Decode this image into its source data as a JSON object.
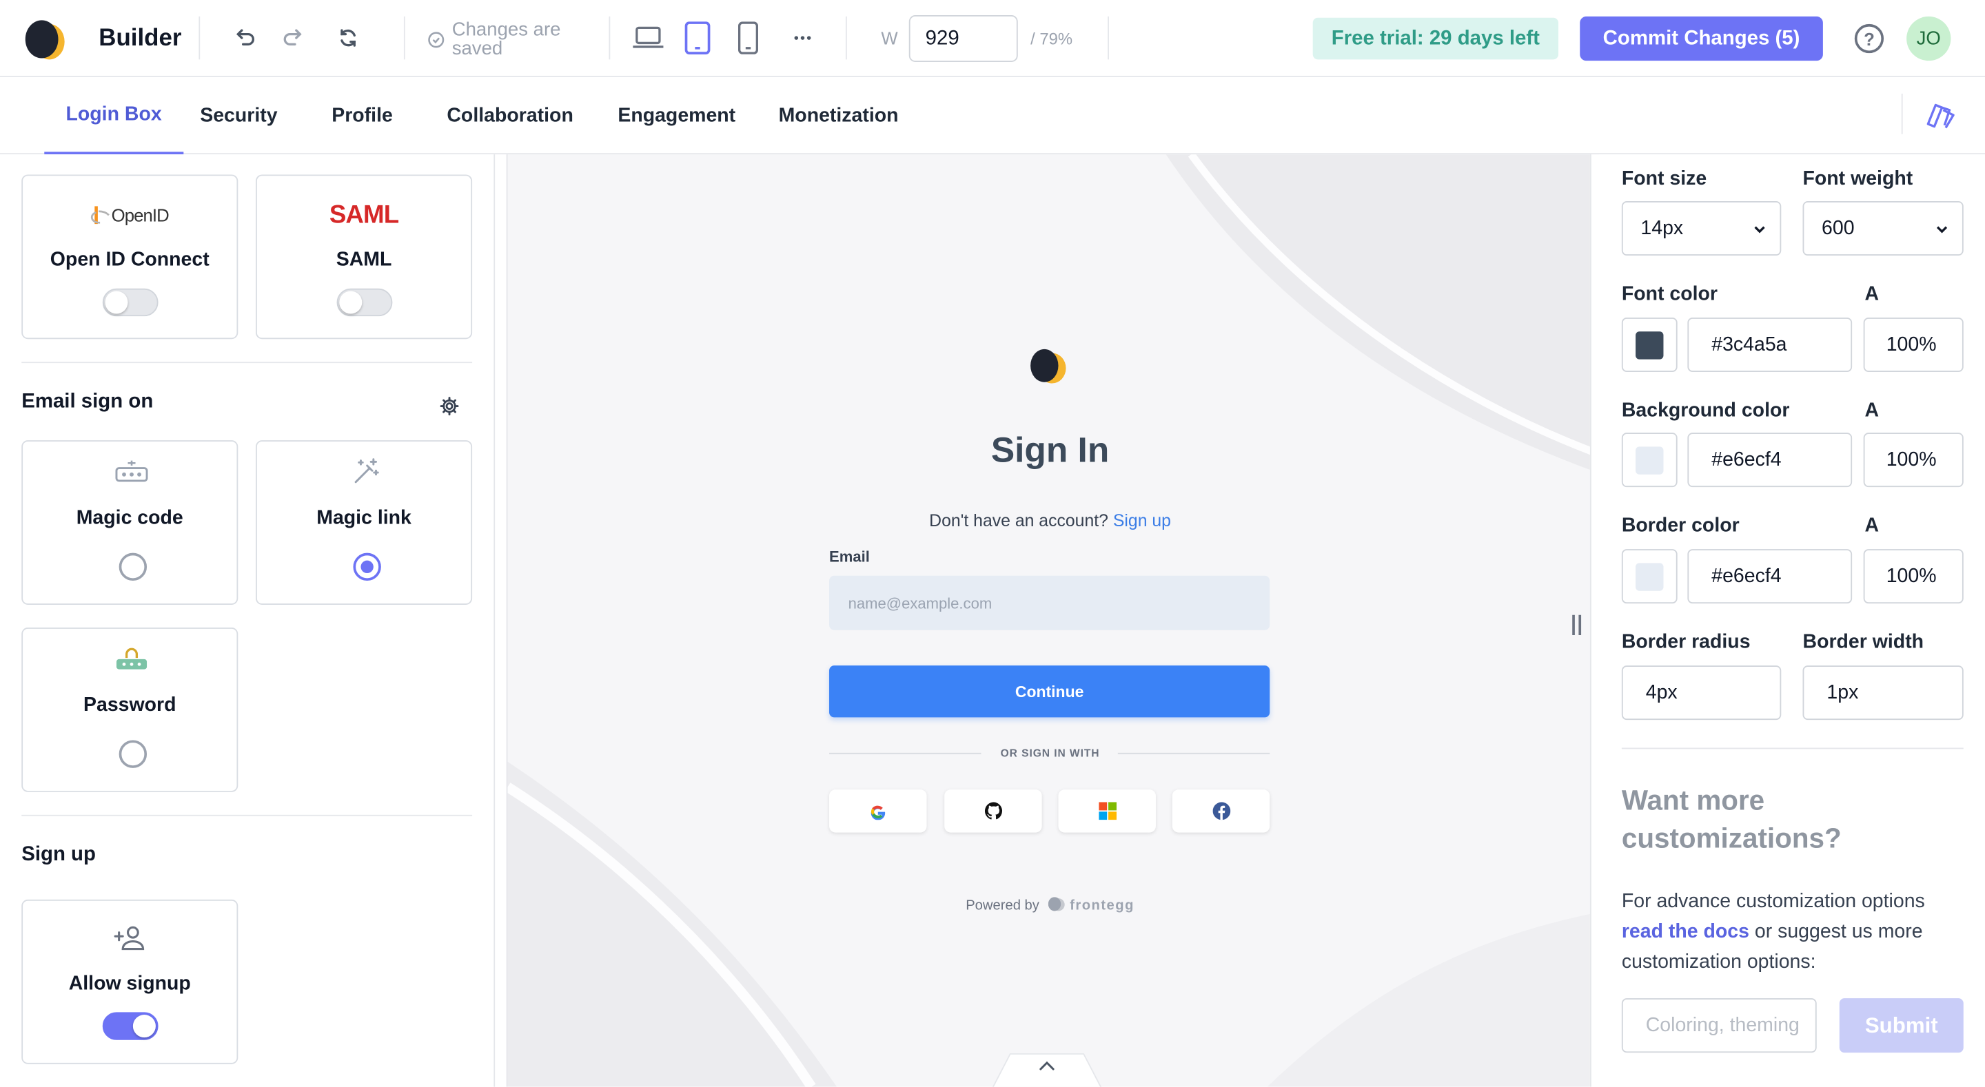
{
  "header": {
    "brand": "Builder",
    "saved_status": "Changes are saved",
    "width_label": "W",
    "width_value": "929",
    "zoom": "/ 79%",
    "trial_badge": "Free trial: 29 days left",
    "commit_button": "Commit Changes (5)",
    "help": "?",
    "avatar_initials": "JO"
  },
  "tabs": [
    {
      "label": "Login Box",
      "active": true
    },
    {
      "label": "Security"
    },
    {
      "label": "Profile"
    },
    {
      "label": "Collaboration"
    },
    {
      "label": "Engagement"
    },
    {
      "label": "Monetization"
    }
  ],
  "left_panel": {
    "sso_cards": [
      {
        "logo_text": "OpenID",
        "title": "Open ID Connect",
        "enabled": false
      },
      {
        "logo_text": "SAML",
        "title": "SAML",
        "enabled": false
      }
    ],
    "email_section_title": "Email sign on",
    "email_cards": [
      {
        "title": "Magic code",
        "selected": false,
        "icon": "dots-icon"
      },
      {
        "title": "Magic link",
        "selected": true,
        "icon": "magic-wand-icon"
      },
      {
        "title": "Password",
        "selected": false,
        "icon": "password-icon"
      }
    ],
    "signup_section_title": "Sign up",
    "signup_card": {
      "title": "Allow signup",
      "enabled": true,
      "icon": "add-user-icon"
    }
  },
  "preview": {
    "title": "Sign In",
    "no_account_text": "Don't have an account?",
    "signup_link": "Sign up",
    "email_label": "Email",
    "email_placeholder": "name@example.com",
    "continue_button": "Continue",
    "or_text": "OR SIGN IN WITH",
    "social_providers": [
      "google-icon",
      "github-icon",
      "microsoft-icon",
      "facebook-icon"
    ],
    "powered_by": "Powered by",
    "powered_brand": "frontegg"
  },
  "right_panel": {
    "font_size_label": "Font size",
    "font_size_value": "14px",
    "font_weight_label": "Font weight",
    "font_weight_value": "600",
    "font_color_label": "Font color",
    "font_color_value": "#3c4a5a",
    "font_color_alpha": "100%",
    "alpha_label": "A",
    "background_color_label": "Background color",
    "background_color_value": "#e6ecf4",
    "background_color_alpha": "100%",
    "border_color_label": "Border color",
    "border_color_value": "#e6ecf4",
    "border_color_alpha": "100%",
    "border_radius_label": "Border radius",
    "border_radius_value": "4px",
    "border_width_label": "Border width",
    "border_width_value": "1px",
    "more_title": "Want more customizations?",
    "more_text_pre": "For advance customization options",
    "more_link": "read the docs",
    "more_text_post": "or suggest us more customization options:",
    "suggest_placeholder": "Coloring, theming",
    "submit_button": "Submit"
  },
  "colors": {
    "accent": "#6d73f5",
    "primary_button": "#3b82f6",
    "trial_bg": "#dbf4ef",
    "trial_text": "#2f9c87"
  }
}
